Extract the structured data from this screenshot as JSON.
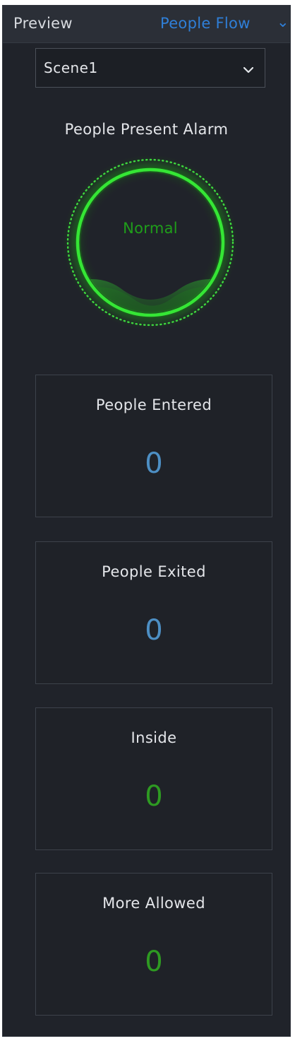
{
  "header": {
    "title": "Preview",
    "link_label": "People Flow",
    "caret": "⌄"
  },
  "scene_select": {
    "value": "Scene1",
    "icon": "chevron-down-icon"
  },
  "alarm": {
    "title": "People Present Alarm",
    "status": "Normal",
    "status_color": "#1f9e1a",
    "ring_color": "#35e635"
  },
  "stats": [
    {
      "label": "People Entered",
      "value": "0",
      "color": "#4d8fc4"
    },
    {
      "label": "People Exited",
      "value": "0",
      "color": "#4d8fc4"
    },
    {
      "label": "Inside",
      "value": "0",
      "color": "#2e9a22"
    },
    {
      "label": "More Allowed",
      "value": "0",
      "color": "#2e9a22"
    }
  ],
  "colors": {
    "panel_bg": "#20232a",
    "header_bg": "#2b2f37",
    "accent": "#2f7fd8"
  }
}
